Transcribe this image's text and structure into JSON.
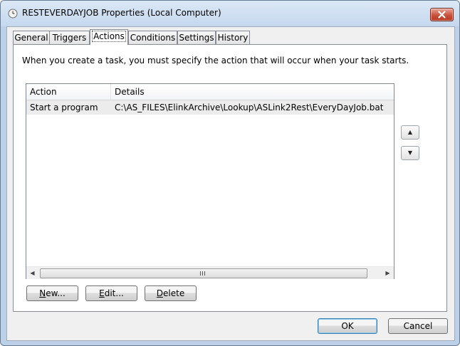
{
  "window": {
    "title": "RESTEVERDAYJOB Properties (Local Computer)",
    "icons": {
      "title": "task-scheduler-clock-icon",
      "close": "close-icon"
    }
  },
  "tabs": [
    {
      "label": "General",
      "active": false
    },
    {
      "label": "Triggers",
      "active": false
    },
    {
      "label": "Actions",
      "active": true
    },
    {
      "label": "Conditions",
      "active": false
    },
    {
      "label": "Settings",
      "active": false
    },
    {
      "label": "History",
      "active": false
    }
  ],
  "actions_tab": {
    "intro_text": "When you create a task, you must specify the action that will occur when your task starts.",
    "table": {
      "columns": [
        "Action",
        "Details"
      ],
      "rows": [
        {
          "action": "Start a program",
          "details": "C:\\AS_FILES\\ElinkArchive\\Lookup\\ASLink2Rest\\EveryDayJob.bat"
        }
      ]
    },
    "move_up_icon": "triangle-up-icon",
    "move_down_icon": "triangle-down-icon",
    "buttons": {
      "new_prefix": "N",
      "new_rest": "ew...",
      "edit_prefix": "E",
      "edit_rest": "dit...",
      "delete_prefix": "D",
      "delete_rest": "elete"
    }
  },
  "footer": {
    "ok_label": "OK",
    "cancel_label": "Cancel"
  },
  "colors": {
    "title_bar": "#c5d8ee",
    "close_button": "#c9523d",
    "default_button_border": "#3c7fb1"
  }
}
